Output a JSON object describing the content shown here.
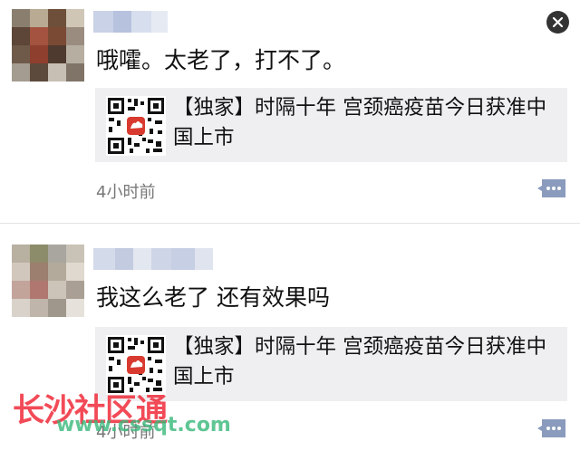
{
  "posts": [
    {
      "text": "哦嚯。太老了，打不了。",
      "card_title": "【独家】时隔十年 宫颈癌疫苗今日获准中国上市",
      "time": "4小时前"
    },
    {
      "text": "我这么老了 还有效果吗",
      "card_title": "【独家】时隔十年 宫颈癌疫苗今日获准中国上市",
      "time": "4小时前"
    }
  ],
  "watermark": {
    "brand": "长沙社区通",
    "url": "www.cssqt.com"
  },
  "icons": {
    "close": "close-icon",
    "comment": "comment-bubble-icon",
    "qr": "qr-code-icon"
  },
  "colors": {
    "card_bg": "#efeff2",
    "time": "#777777",
    "comment_icon": "#8a9bbd",
    "watermark_red": "#f02b3a",
    "watermark_green": "#38b87a"
  }
}
